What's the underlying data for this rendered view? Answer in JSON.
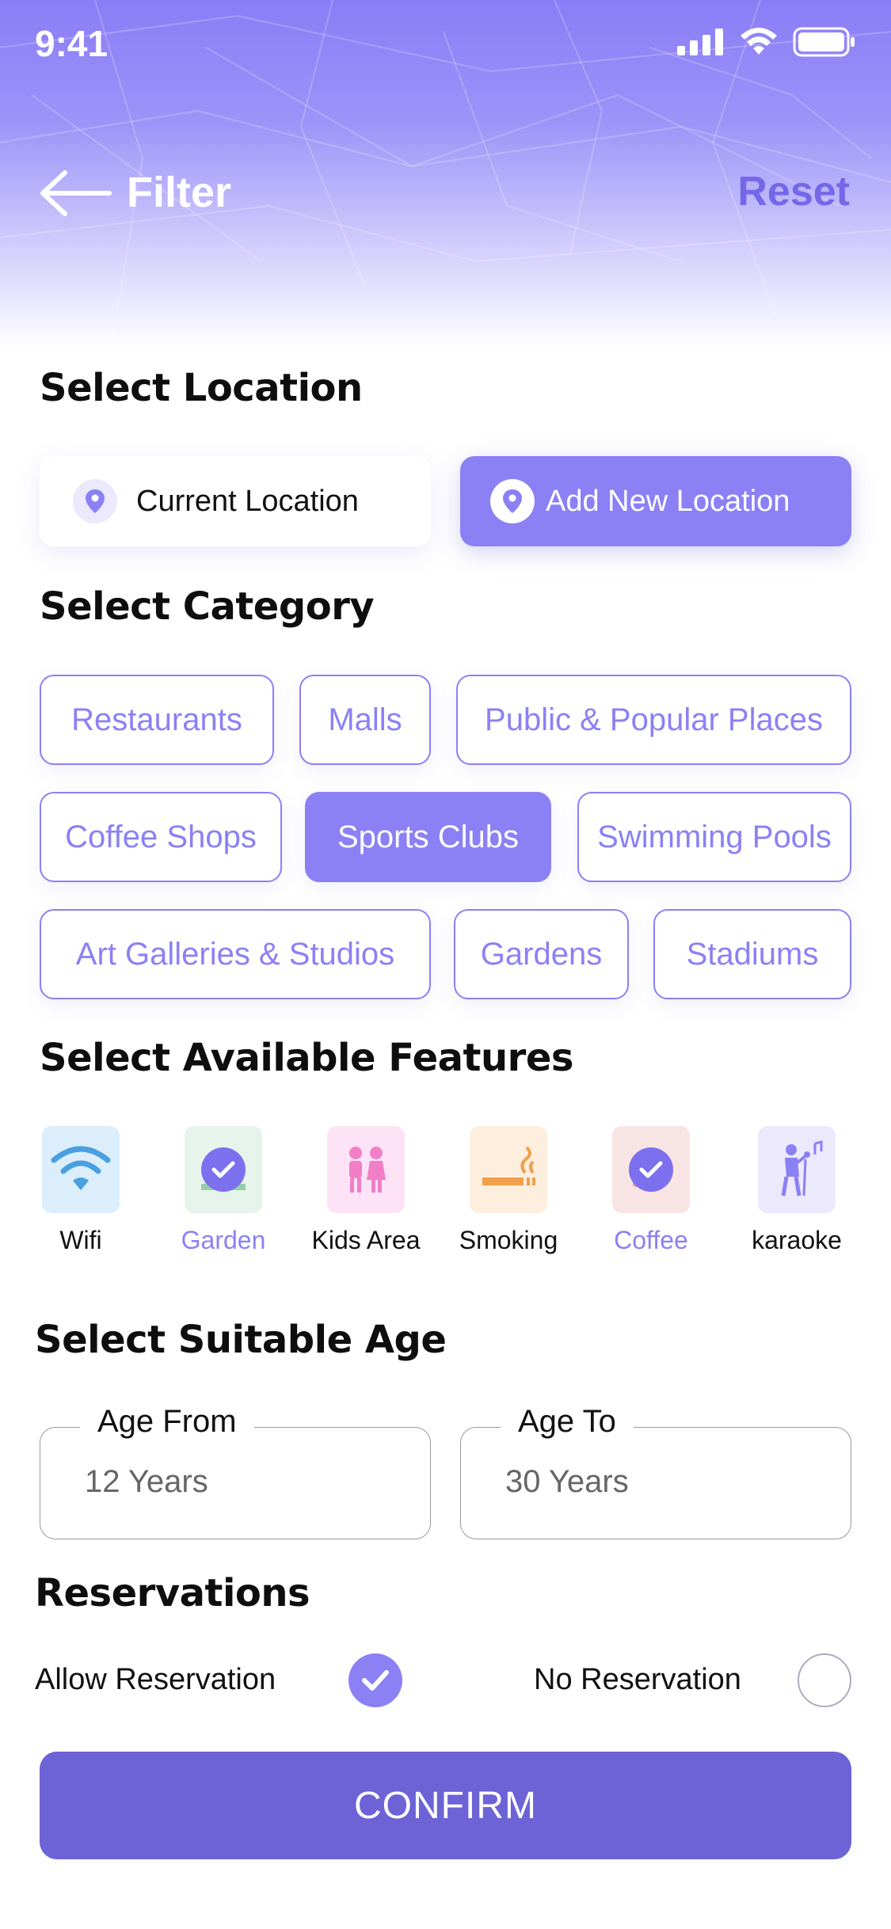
{
  "status_bar": {
    "time": "9:41"
  },
  "header": {
    "title": "Filter",
    "reset_label": "Reset"
  },
  "location": {
    "heading": "Select Location",
    "current_label": "Current Location",
    "add_label": "Add New Location"
  },
  "category": {
    "heading": "Select Category",
    "items": [
      {
        "label": "Restaurants",
        "selected": false
      },
      {
        "label": "Malls",
        "selected": false
      },
      {
        "label": "Public & Popular Places",
        "selected": false
      },
      {
        "label": "Coffee Shops",
        "selected": false
      },
      {
        "label": "Sports Clubs",
        "selected": true
      },
      {
        "label": "Swimming Pools",
        "selected": false
      },
      {
        "label": "Art Galleries & Studios",
        "selected": false
      },
      {
        "label": "Gardens",
        "selected": false
      },
      {
        "label": "Stadiums",
        "selected": false
      }
    ]
  },
  "features": {
    "heading": "Select Available Features",
    "items": [
      {
        "label": "Wifi",
        "icon": "wifi-icon",
        "selected": false
      },
      {
        "label": "Garden",
        "icon": "garden-icon",
        "selected": true
      },
      {
        "label": "Kids Area",
        "icon": "kids-icon",
        "selected": false
      },
      {
        "label": "Smoking",
        "icon": "smoking-icon",
        "selected": false
      },
      {
        "label": "Coffee",
        "icon": "coffee-icon",
        "selected": true
      },
      {
        "label": "karaoke",
        "icon": "karaoke-icon",
        "selected": false
      }
    ]
  },
  "age": {
    "heading": "Select Suitable Age",
    "from_label": "Age From",
    "from_value": "12 Years",
    "to_label": "Age To",
    "to_value": "30 Years"
  },
  "reservations": {
    "heading": "Reservations",
    "allow_label": "Allow Reservation",
    "allow_checked": true,
    "none_label": "No Reservation",
    "none_checked": false
  },
  "confirm_label": "CONFIRM",
  "colors": {
    "accent": "#8c80f5",
    "confirm": "#6d63d6"
  }
}
